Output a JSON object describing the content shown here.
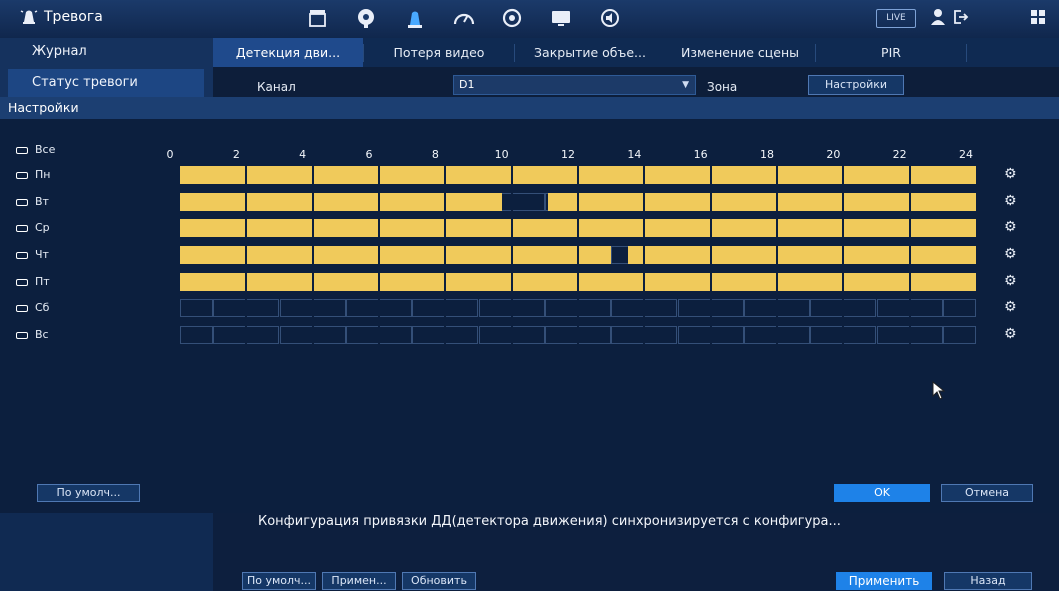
{
  "app": {
    "title": "Тревога",
    "live_label": "LIVE"
  },
  "left_nav": [
    {
      "label": "Журнал",
      "active": false
    },
    {
      "label": "Статус тревоги",
      "active": true
    }
  ],
  "tabs": [
    {
      "label": "Детекция дви...",
      "active": true
    },
    {
      "label": "Потеря видео",
      "active": false
    },
    {
      "label": "Закрытие объе...",
      "active": false
    },
    {
      "label": "Изменение сцены",
      "active": false
    },
    {
      "label": "PIR",
      "active": false
    }
  ],
  "channel": {
    "label": "Канал",
    "value": "D1",
    "zone_label": "Зона",
    "settings_button": "Настройки"
  },
  "section_title": "Настройки",
  "schedule": {
    "all_label": "Все",
    "axis": [
      "0",
      "2",
      "4",
      "6",
      "8",
      "10",
      "12",
      "14",
      "16",
      "18",
      "20",
      "22",
      "24"
    ],
    "days": [
      {
        "label": "Пн",
        "ranges": [
          [
            0,
            24
          ]
        ]
      },
      {
        "label": "Вт",
        "ranges": [
          [
            0,
            9.7
          ],
          [
            11.1,
            24
          ]
        ]
      },
      {
        "label": "Ср",
        "ranges": [
          [
            0,
            24
          ]
        ]
      },
      {
        "label": "Чт",
        "ranges": [
          [
            0,
            13.0
          ],
          [
            13.5,
            24
          ]
        ]
      },
      {
        "label": "Пт",
        "ranges": [
          [
            0,
            24
          ]
        ]
      },
      {
        "label": "Сб",
        "ranges": []
      },
      {
        "label": "Вс",
        "ranges": []
      }
    ]
  },
  "buttons": {
    "default": "По умолч...",
    "ok": "OK",
    "cancel": "Отмена",
    "footer_default": "По умолч...",
    "footer_apply_short": "Примен...",
    "footer_refresh": "Обновить",
    "footer_apply": "Применить",
    "footer_back": "Назад"
  },
  "note": "Конфигурация привязки ДД(детектора движения) синхронизируется с конфигура...",
  "colors": {
    "accent": "#1e82e8",
    "schedule_fill": "#f0ca5b",
    "background": "#0d1e3a"
  }
}
